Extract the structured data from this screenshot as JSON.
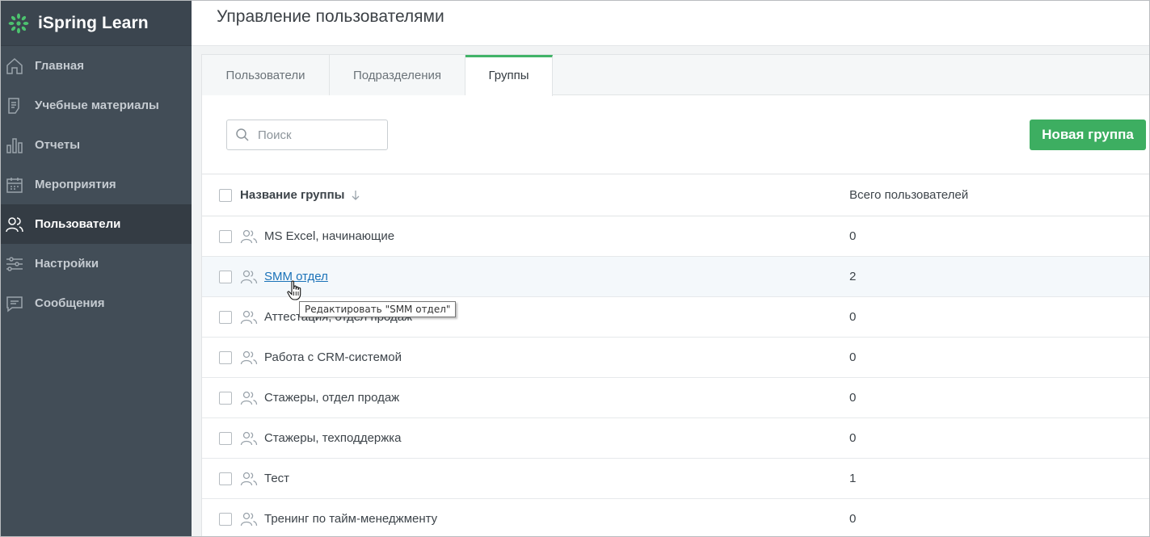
{
  "app": {
    "name": "iSpring Learn",
    "accent": "#41b368"
  },
  "sidebar": {
    "items": [
      {
        "label": "Главная",
        "icon": "home-icon",
        "active": false
      },
      {
        "label": "Учебные материалы",
        "icon": "materials-icon",
        "active": false
      },
      {
        "label": "Отчеты",
        "icon": "reports-icon",
        "active": false
      },
      {
        "label": "Мероприятия",
        "icon": "calendar-icon",
        "active": false
      },
      {
        "label": "Пользователи",
        "icon": "users-icon",
        "active": true
      },
      {
        "label": "Настройки",
        "icon": "settings-sliders-icon",
        "active": false
      },
      {
        "label": "Сообщения",
        "icon": "messages-icon",
        "active": false
      }
    ]
  },
  "header": {
    "title": "Управление пользователями"
  },
  "tabs": [
    {
      "label": "Пользователи",
      "active": false
    },
    {
      "label": "Подразделения",
      "active": false
    },
    {
      "label": "Группы",
      "active": true
    }
  ],
  "toolbar": {
    "search_placeholder": "Поиск",
    "new_group_label": "Новая группа"
  },
  "table": {
    "columns": [
      "Название группы",
      "Всего пользователей"
    ],
    "rows": [
      {
        "name": "MS Excel, начинающие",
        "count": "0"
      },
      {
        "name": "SMM отдел",
        "count": "2"
      },
      {
        "name": "Аттестация, отдел продаж",
        "count": "0"
      },
      {
        "name": "Работа с CRM-системой",
        "count": "0"
      },
      {
        "name": "Стажеры, отдел продаж",
        "count": "0"
      },
      {
        "name": "Стажеры, техподдержка",
        "count": "0"
      },
      {
        "name": "Тест",
        "count": "1"
      },
      {
        "name": "Тренинг по тайм-менеджменту",
        "count": "0"
      }
    ]
  },
  "tooltip": {
    "text": "Редактировать \"SMM отдел\""
  }
}
